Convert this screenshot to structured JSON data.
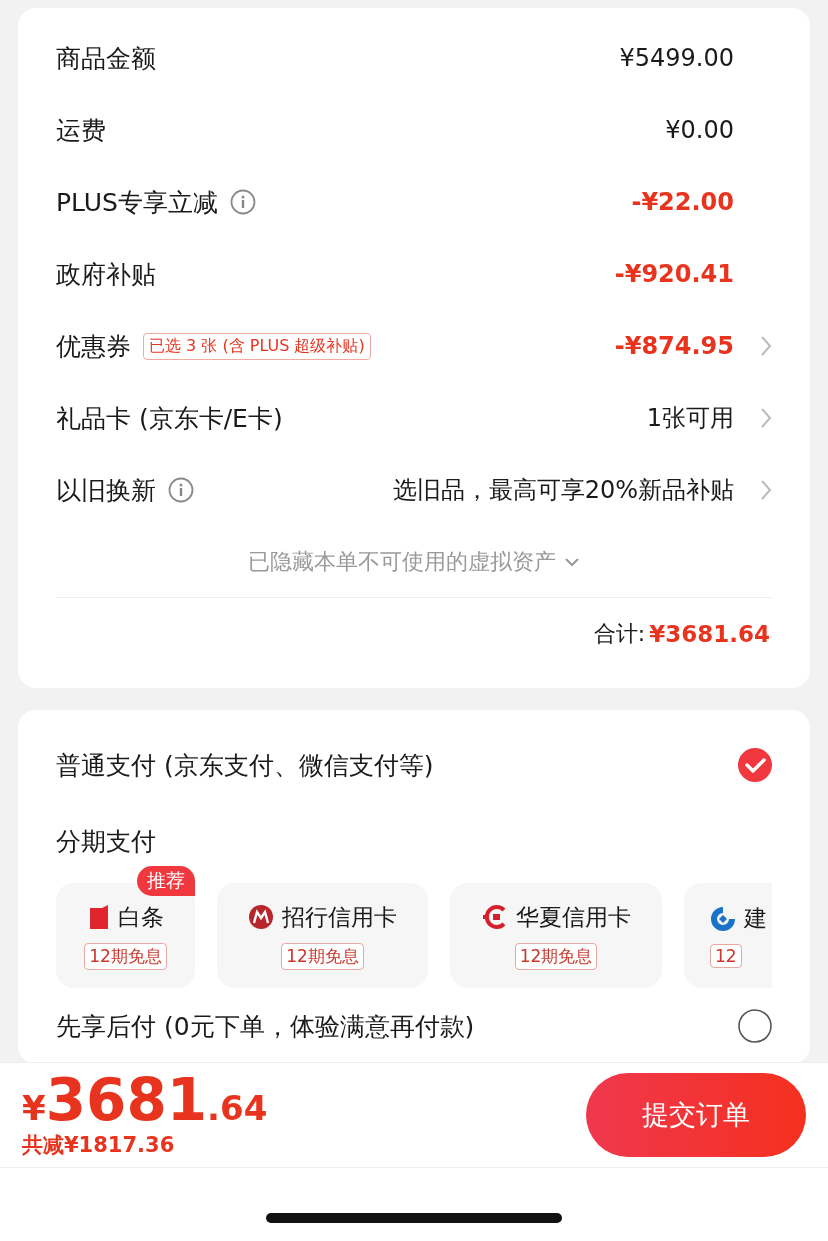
{
  "summary": {
    "rows": [
      {
        "label": "商品金额",
        "info": false,
        "tag": null,
        "value": "¥5499.00",
        "discount": false,
        "chevron": false
      },
      {
        "label": "运费",
        "info": false,
        "tag": null,
        "value": "¥0.00",
        "discount": false,
        "chevron": false
      },
      {
        "label": "PLUS专享立减",
        "info": true,
        "tag": null,
        "value": "-¥22.00",
        "discount": true,
        "chevron": false
      },
      {
        "label": "政府补贴",
        "info": false,
        "tag": null,
        "value": "-¥920.41",
        "discount": true,
        "chevron": false
      },
      {
        "label": "优惠券",
        "info": false,
        "tag": "已选 3 张 (含 PLUS 超级补贴)",
        "value": "-¥874.95",
        "discount": true,
        "chevron": true
      },
      {
        "label": "礼品卡 (京东卡/E卡)",
        "info": false,
        "tag": null,
        "value": "1张可用",
        "discount": false,
        "chevron": true
      },
      {
        "label": "以旧换新",
        "info": true,
        "tag": null,
        "value": "选旧品，最高可享20%新品补贴",
        "discount": false,
        "chevron": true
      }
    ],
    "hidden_note": "已隐藏本单不可使用的虚拟资产",
    "total_label": "合计:",
    "total_value": "¥3681.64"
  },
  "payment": {
    "normal": {
      "label": "普通支付 (京东支付、微信支付等)",
      "selected": true
    },
    "installment": {
      "title": "分期支付",
      "plans": [
        {
          "kind": "baitiao",
          "name": "白条",
          "tag": "12期免息",
          "badge": "推荐"
        },
        {
          "kind": "cmb",
          "name": "招行信用卡",
          "tag": "12期免息"
        },
        {
          "kind": "hxb",
          "name": "华夏信用卡",
          "tag": "12期免息"
        },
        {
          "kind": "ccb",
          "name": "建",
          "tag": "12"
        }
      ]
    },
    "later": {
      "label": "先享后付 (0元下单，体验满意再付款)",
      "selected": false
    }
  },
  "bottom_bar": {
    "currency": "¥",
    "price_integer": "3681",
    "price_decimal": ".64",
    "saved": "共减¥1817.36",
    "submit": "提交订单"
  }
}
